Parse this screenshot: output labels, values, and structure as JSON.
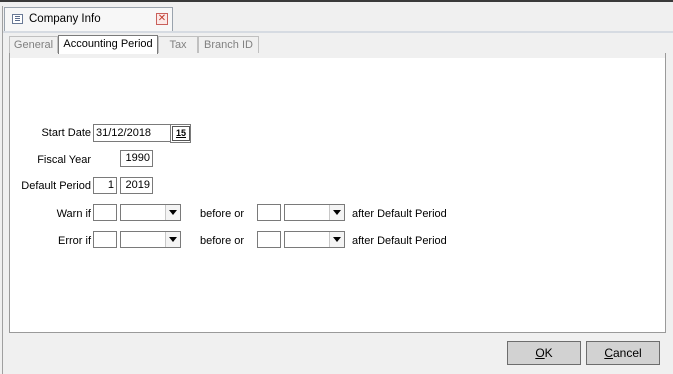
{
  "window": {
    "tab_title": "Company Info",
    "icon": "list-form-icon",
    "close_icon": "close-icon"
  },
  "tabs": [
    {
      "label": "General",
      "active": false
    },
    {
      "label": "Accounting Period",
      "active": true
    },
    {
      "label": "Tax",
      "active": false
    },
    {
      "label": "Branch ID",
      "active": false
    }
  ],
  "form": {
    "start_date_label": "Start Date",
    "start_date_value": "31/12/2018",
    "calendar_icon_text": "15",
    "fiscal_year_label": "Fiscal Year",
    "fiscal_year_value": "1990",
    "default_period_label": "Default Period",
    "default_period_value": "1",
    "default_period_year": "2019",
    "warn_label": "Warn if",
    "error_label": "Error if",
    "before_or_label": "before or",
    "after_label": "after Default Period"
  },
  "buttons": {
    "ok_mnemonic": "O",
    "ok_rest": "K",
    "cancel_mnemonic": "C",
    "cancel_rest": "ancel"
  }
}
